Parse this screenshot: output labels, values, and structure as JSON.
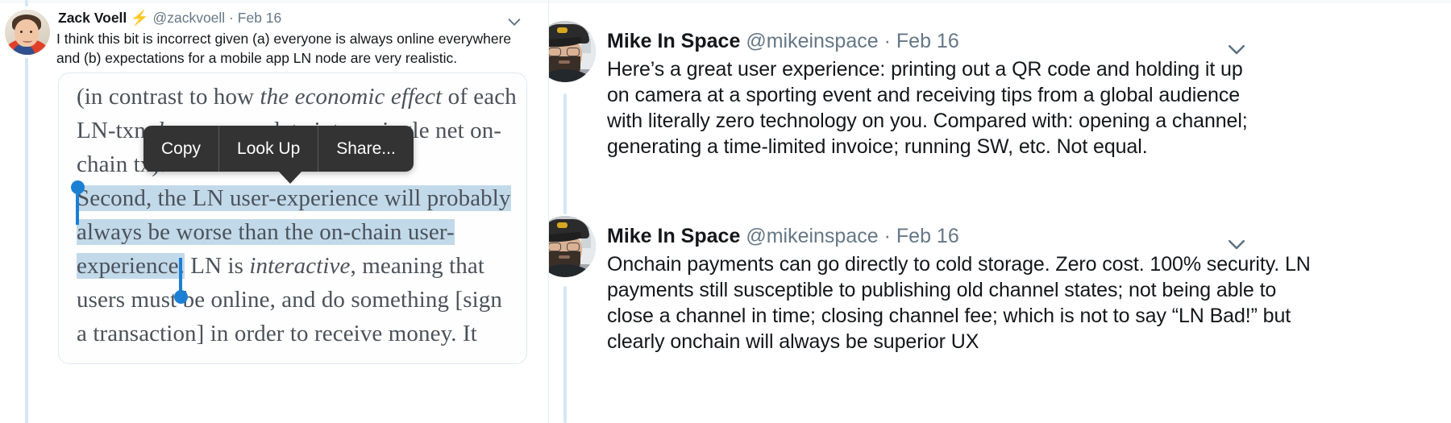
{
  "left_panel": {
    "tweet": {
      "display_name": "Zack Voell",
      "badge_icon": "lightning-bolt-icon",
      "handle": "@zackvoell",
      "separator": "·",
      "date": "Feb 16",
      "caret_icon": "chevron-down-icon",
      "body": "I think this bit is incorrect given (a) everyone is always online everywhere and (b) expectations for a mobile app LN node are very realistic.",
      "avatar_alt": "zack-voell-avatar"
    },
    "book_card": {
      "line1_pre": "(in contrast to how ",
      "line1_italic": "the economic effect",
      "line1_post": " of each",
      "line2_pre": "LN-txn ",
      "line2_italic": "does",
      "line2_post": " accumulate into a single net on-",
      "line3": "chain tx).",
      "highlight_line1": "Second, the LN user-experience will probably",
      "highlight_line2": "always be worse than the on-chain user-",
      "highlight_line3": "experience.",
      "after_pre": " LN is ",
      "after_italic": "interactive",
      "after_post": ", meaning that",
      "line5": "users must be online, and do something [sign",
      "line6": "a transaction] in order to receive money. It"
    },
    "context_menu": {
      "items": [
        {
          "label": "Copy",
          "name": "copy"
        },
        {
          "label": "Look Up",
          "name": "look-up"
        },
        {
          "label": "Share...",
          "name": "share"
        }
      ]
    },
    "selection": {
      "handle_color": "#1b7fd4",
      "highlight_color": "#c2d9ea"
    }
  },
  "right_panel": {
    "tweets": [
      {
        "display_name": "Mike In Space",
        "handle": "@mikeinspace",
        "separator": "·",
        "date": "Feb 16",
        "caret_icon": "chevron-down-icon",
        "avatar_alt": "mike-in-space-avatar",
        "body": "Here’s a great user experience: printing out a QR code and holding it up on camera at a sporting event and receiving tips from a global audience with literally zero technology on you. Compared with: opening a channel; generating a time-limited invoice; running SW, etc. Not equal."
      },
      {
        "display_name": "Mike In Space",
        "handle": "@mikeinspace",
        "separator": "·",
        "date": "Feb 16",
        "caret_icon": "chevron-down-icon",
        "avatar_alt": "mike-in-space-avatar",
        "body": "Onchain payments can go directly to cold storage. Zero cost. 100% security. LN payments still susceptible to publishing old channel states; not being able to close a channel in time; closing channel fee; which is not to say “LN Bad!” but clearly onchain will always be superior UX"
      }
    ]
  },
  "colors": {
    "link_blue": "#1da1f2",
    "text_dark": "#14171a",
    "text_muted": "#657786",
    "thread_line": "#ccd6dd",
    "thread_line_light": "#d6e7f5",
    "menu_bg": "#333333",
    "selection_blue": "#1b7fd4",
    "highlight_blue": "#c2d9ea",
    "card_border": "#e1e8ed"
  }
}
